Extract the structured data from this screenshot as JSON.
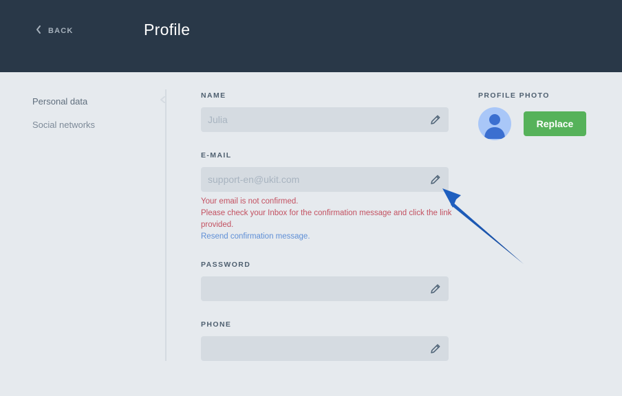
{
  "header": {
    "back_label": "BACK",
    "title": "Profile"
  },
  "sidebar": {
    "items": [
      {
        "label": "Personal data"
      },
      {
        "label": "Social networks"
      }
    ]
  },
  "form": {
    "name": {
      "label": "NAME",
      "value": "Julia"
    },
    "email": {
      "label": "E-MAIL",
      "value": "support-en@ukit.com"
    },
    "email_error": {
      "line1": "Your email is not confirmed.",
      "line2": "Please check your Inbox for the confirmation message and click the link provided.",
      "resend_link": "Resend confirmation message."
    },
    "password": {
      "label": "PASSWORD",
      "value": ""
    },
    "phone": {
      "label": "PHONE",
      "value": ""
    }
  },
  "profile_photo": {
    "label": "PROFILE PHOTO",
    "replace_label": "Replace"
  },
  "icons": {
    "back": "chevron-left-icon",
    "edit": "pencil-icon",
    "avatar": "user-silhouette-icon",
    "annotation": "arrow-icon"
  },
  "colors": {
    "header_bg": "#293848",
    "page_bg": "#e6eaee",
    "field_bg": "#d5dbe1",
    "button_green": "#56b25a",
    "error_red": "#c35161",
    "link_blue": "#5f8fd6",
    "annotation_arrow": "#1f5fbf"
  }
}
